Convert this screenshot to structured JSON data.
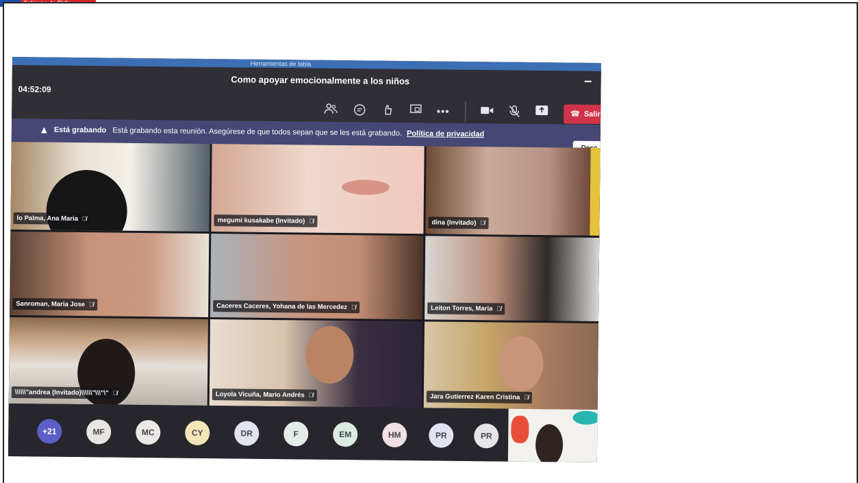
{
  "corner_logo": {
    "text": "Gobierno de Chile"
  },
  "window": {
    "pre_bar_text": "Herramientas de tabla",
    "meeting_title": "Como apoyar emocionalmente a los niños",
    "timer": "04:52:09",
    "leave_label": "Salir"
  },
  "toolbar": {
    "icons": [
      "participants-icon",
      "chat-icon",
      "reactions-icon",
      "share-screen-icon",
      "more-options-icon",
      "camera-icon",
      "mic-muted-icon",
      "share-tray-icon"
    ]
  },
  "recording_banner": {
    "heading": "Está grabando",
    "message": "Está grabando esta reunión. Asegúrese de que todos sepan que se les está grabando.",
    "privacy_link": "Política de privacidad",
    "dismiss_label": "Desc"
  },
  "participants": [
    {
      "name": "lo Palma, Ana Maria"
    },
    {
      "name": "megumi kusakabe (Invitado)"
    },
    {
      "name": "dina (Invitado)"
    },
    {
      "name": "Sanroman, Maria Jose"
    },
    {
      "name": "Caceres Caceres, Yohana de las Mercedez"
    },
    {
      "name": "Leiton Torres, Maria"
    },
    {
      "name": "\\\\\\\\\\\\\"andrea (Invitado)\\\\\\\\\\\\\"\\\\\\\"\\\""
    },
    {
      "name": "Loyola Vicuña, Mario Andrés"
    },
    {
      "name": "Jara Gutierrez Karen Cristina"
    }
  ],
  "roster": {
    "overflow": "+21",
    "initials": [
      "MF",
      "MC",
      "CY",
      "DR",
      "F",
      "EM",
      "HM",
      "PR",
      "PR"
    ],
    "colors": [
      "#e9e6e2",
      "#ece8e6",
      "#f2e6b8",
      "#e3e5ee",
      "#e4ecea",
      "#dcebe1",
      "#f1dfe6",
      "#e0e3f2",
      "#e6e6ea"
    ]
  }
}
